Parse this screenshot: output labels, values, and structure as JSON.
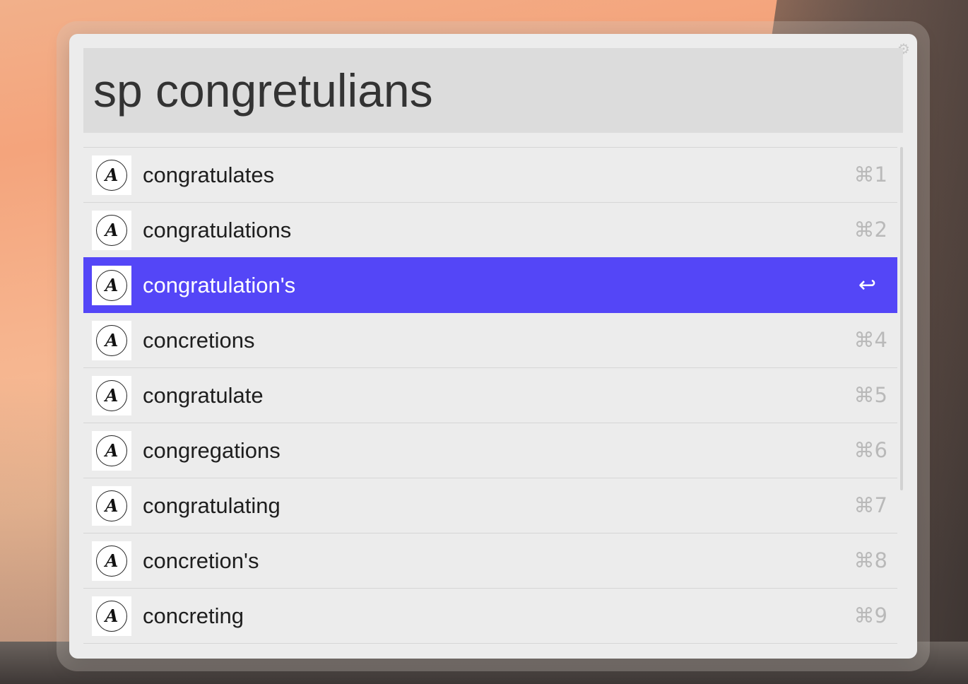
{
  "window": {
    "gear_icon": "gear-icon",
    "query": "sp congretulians"
  },
  "results": [
    {
      "label": "congratulates",
      "shortcut": "⌘1",
      "icon": "dictionary-icon",
      "selected": false
    },
    {
      "label": "congratulations",
      "shortcut": "⌘2",
      "icon": "dictionary-icon",
      "selected": false
    },
    {
      "label": "congratulation's",
      "shortcut": "↩",
      "icon": "dictionary-icon",
      "selected": true
    },
    {
      "label": "concretions",
      "shortcut": "⌘4",
      "icon": "dictionary-icon",
      "selected": false
    },
    {
      "label": "congratulate",
      "shortcut": "⌘5",
      "icon": "dictionary-icon",
      "selected": false
    },
    {
      "label": "congregations",
      "shortcut": "⌘6",
      "icon": "dictionary-icon",
      "selected": false
    },
    {
      "label": "congratulating",
      "shortcut": "⌘7",
      "icon": "dictionary-icon",
      "selected": false
    },
    {
      "label": "concretion's",
      "shortcut": "⌘8",
      "icon": "dictionary-icon",
      "selected": false
    },
    {
      "label": "concreting",
      "shortcut": "⌘9",
      "icon": "dictionary-icon",
      "selected": false
    }
  ],
  "colors": {
    "selection": "#5446f7",
    "window_bg": "#ececec",
    "search_bg": "#dcdcdc"
  }
}
